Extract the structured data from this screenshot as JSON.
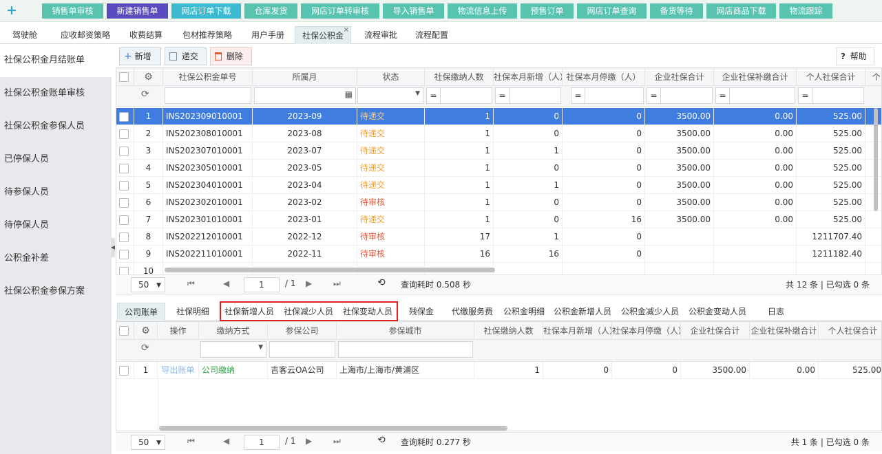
{
  "topbar": {
    "plus": "+",
    "buttons": [
      {
        "label": "销售单审核",
        "bg": "#58c4b0"
      },
      {
        "label": "新建销售单",
        "bg": "#5a4bbf"
      },
      {
        "label": "网店订单下载",
        "bg": "#3dbad0"
      },
      {
        "label": "仓库发货",
        "bg": "#58c4b0"
      },
      {
        "label": "网店订单转审核",
        "bg": "#58c4b0"
      },
      {
        "label": "导入销售单",
        "bg": "#58c4b0"
      },
      {
        "label": "物流信息上传",
        "bg": "#58c4b0"
      },
      {
        "label": "预售订单",
        "bg": "#58c4b0"
      },
      {
        "label": "网店订单查询",
        "bg": "#58c4b0"
      },
      {
        "label": "备货等待",
        "bg": "#58c4b0"
      },
      {
        "label": "网店商品下载",
        "bg": "#58c4b0"
      },
      {
        "label": "物流跟踪",
        "bg": "#58c4b0"
      }
    ]
  },
  "tabs": [
    "驾驶舱",
    "应收邮资策略",
    "收费结算",
    "包材推荐策略",
    "用户手册",
    "社保公积金",
    "流程审批",
    "流程配置"
  ],
  "tab_close": "×",
  "sidebar": [
    "社保公积金月结账单",
    "社保公积金账单审核",
    "社保公积金参保人员",
    "已停保人员",
    "待参保人员",
    "待停保人员",
    "公积金补差",
    "社保公积金参保方案"
  ],
  "toolbar": {
    "add": "新增",
    "submit": "递交",
    "delete": "删除",
    "help": "帮助",
    "add_icon": "+",
    "help_icon": "?"
  },
  "grid": {
    "headers": [
      "社保公积金单号",
      "所属月",
      "状态",
      "社保缴纳人数",
      "社保本月新增（人）",
      "社保本月停缴（人）",
      "企业社保合计",
      "企业社保补缴合计",
      "个人社保合计",
      "个"
    ],
    "eq": "=",
    "rows": [
      {
        "n": "1",
        "id": "INS202309010001",
        "month": "2023-09",
        "status": "待递交",
        "st": "orange",
        "count": "1",
        "add": "0",
        "stop": "0",
        "corp": "3500.00",
        "corp_extra": "0.00",
        "personal": "525.00"
      },
      {
        "n": "2",
        "id": "INS202308010001",
        "month": "2023-08",
        "status": "待递交",
        "st": "orange",
        "count": "1",
        "add": "0",
        "stop": "0",
        "corp": "3500.00",
        "corp_extra": "0.00",
        "personal": "525.00"
      },
      {
        "n": "3",
        "id": "INS202307010001",
        "month": "2023-07",
        "status": "待递交",
        "st": "orange",
        "count": "1",
        "add": "1",
        "stop": "0",
        "corp": "3500.00",
        "corp_extra": "0.00",
        "personal": "525.00"
      },
      {
        "n": "4",
        "id": "INS202305010001",
        "month": "2023-05",
        "status": "待递交",
        "st": "orange",
        "count": "1",
        "add": "0",
        "stop": "0",
        "corp": "3500.00",
        "corp_extra": "0.00",
        "personal": "525.00"
      },
      {
        "n": "5",
        "id": "INS202304010001",
        "month": "2023-04",
        "status": "待递交",
        "st": "orange",
        "count": "1",
        "add": "1",
        "stop": "0",
        "corp": "3500.00",
        "corp_extra": "0.00",
        "personal": "525.00"
      },
      {
        "n": "6",
        "id": "INS202302010001",
        "month": "2023-02",
        "status": "待审核",
        "st": "red",
        "count": "1",
        "add": "0",
        "stop": "0",
        "corp": "3500.00",
        "corp_extra": "0.00",
        "personal": "525.00"
      },
      {
        "n": "7",
        "id": "INS202301010001",
        "month": "2023-01",
        "status": "待递交",
        "st": "orange",
        "count": "1",
        "add": "0",
        "stop": "16",
        "corp": "3500.00",
        "corp_extra": "0.00",
        "personal": "525.00"
      },
      {
        "n": "8",
        "id": "INS202212010001",
        "month": "2022-12",
        "status": "待审核",
        "st": "red",
        "count": "17",
        "add": "1",
        "stop": "0",
        "corp": "",
        "corp_extra": "",
        "personal": "1211707.40"
      },
      {
        "n": "9",
        "id": "INS202211010001",
        "month": "2022-11",
        "status": "待审核",
        "st": "red",
        "count": "16",
        "add": "16",
        "stop": "0",
        "corp": "",
        "corp_extra": "",
        "personal": "1211182.40"
      },
      {
        "n": "10",
        "id": "",
        "month": "",
        "status": "",
        "st": "orange",
        "count": "",
        "add": "",
        "stop": "",
        "corp": "",
        "corp_extra": "",
        "personal": ""
      }
    ]
  },
  "pager1": {
    "size": "50",
    "page": "1",
    "total_pages": "/ 1",
    "time": "查询耗时 0.508 秒",
    "summary": "共 12 条 | 已勾选 0 条"
  },
  "btabs": [
    "公司账单",
    "社保明细",
    "社保新增人员",
    "社保减少人员",
    "社保变动人员",
    "残保金",
    "代缴服务费",
    "公积金明细",
    "公积金新增人员",
    "公积金减少人员",
    "公积金变动人员",
    "日志"
  ],
  "grid2": {
    "headers": [
      "操作",
      "缴纳方式",
      "参保公司",
      "参保城市",
      "社保缴纳人数",
      "社保本月新增（人）",
      "社保本月停缴（人）",
      "企业社保合计",
      "企业社保补缴合计",
      "个人社保合计"
    ],
    "row": {
      "n": "1",
      "op": "导出账单",
      "method": "公司缴纳",
      "company": "吉客云OA公司",
      "city": "上海市/上海市/黄浦区",
      "count": "1",
      "add": "0",
      "stop": "0",
      "corp": "3500.00",
      "corp_extra": "0.00",
      "personal": "525.00"
    }
  },
  "pager2": {
    "size": "50",
    "page": "1",
    "total_pages": "/ 1",
    "time": "查询耗时 0.277 秒",
    "summary": "共 1 条 | 已勾选 0 条"
  },
  "colors": {
    "accent": "#3f7ee0",
    "orange": "#f0a132",
    "red": "#e05a3a",
    "green": "#2da84a",
    "link": "#8fb7e6"
  }
}
